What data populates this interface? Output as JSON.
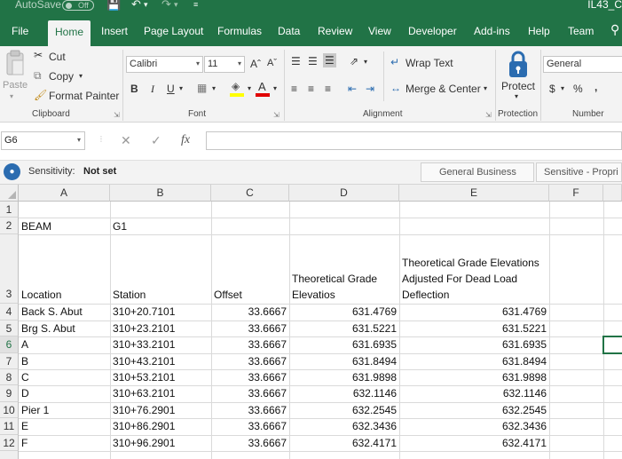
{
  "titlebar": {
    "autosave": "AutoSave",
    "autosave_state": "Off",
    "doc_name": "IL43_C"
  },
  "tabs": [
    {
      "label": "File"
    },
    {
      "label": "Home"
    },
    {
      "label": "Insert"
    },
    {
      "label": "Page Layout"
    },
    {
      "label": "Formulas"
    },
    {
      "label": "Data"
    },
    {
      "label": "Review"
    },
    {
      "label": "View"
    },
    {
      "label": "Developer"
    },
    {
      "label": "Add-ins"
    },
    {
      "label": "Help"
    },
    {
      "label": "Team"
    }
  ],
  "ribbon": {
    "clipboard": {
      "label": "Clipboard",
      "paste": "Paste",
      "cut": "Cut",
      "copy": "Copy",
      "format_painter": "Format Painter"
    },
    "font": {
      "label": "Font",
      "name": "Calibri",
      "size": "11",
      "bold": "B",
      "italic": "I",
      "underline": "U"
    },
    "alignment": {
      "label": "Alignment",
      "wrap_text": "Wrap Text",
      "merge_center": "Merge & Center"
    },
    "protection": {
      "label": "Protection",
      "protect": "Protect"
    },
    "number": {
      "label": "Number",
      "format": "General",
      "currency": "$",
      "percent": "%",
      "comma": ","
    }
  },
  "formula_bar": {
    "name_box": "G6",
    "fx": "fx",
    "formula": ""
  },
  "sensitivity": {
    "label": "Sensitivity:",
    "value": "Not set",
    "chips": [
      "General Business",
      "Sensitive - Propri"
    ]
  },
  "sheet": {
    "columns": [
      "A",
      "B",
      "C",
      "D",
      "E",
      "F"
    ],
    "rows": [
      "1",
      "2",
      "3",
      "4",
      "5",
      "6",
      "7",
      "8",
      "9",
      "10",
      "11",
      "12"
    ],
    "active_row": "6",
    "beam_label": "BEAM",
    "beam_value": "G1",
    "headers": {
      "location": "Location",
      "station": "Station",
      "offset": "Offset",
      "theoretical": "Theoretical Grade Elevatios",
      "adjusted": "Theoretical Grade Elevations Adjusted For Dead Load Deflection"
    },
    "data": [
      {
        "location": "Back  S. Abut",
        "station": "310+20.7101",
        "offset": "33.6667",
        "theo": "631.4769",
        "adj": "631.4769"
      },
      {
        "location": "Brg S. Abut",
        "station": "310+23.2101",
        "offset": "33.6667",
        "theo": "631.5221",
        "adj": "631.5221"
      },
      {
        "location": "A",
        "station": "310+33.2101",
        "offset": "33.6667",
        "theo": "631.6935",
        "adj": "631.6935"
      },
      {
        "location": "B",
        "station": "310+43.2101",
        "offset": "33.6667",
        "theo": "631.8494",
        "adj": "631.8494"
      },
      {
        "location": "C",
        "station": "310+53.2101",
        "offset": "33.6667",
        "theo": "631.9898",
        "adj": "631.9898"
      },
      {
        "location": "D",
        "station": "310+63.2101",
        "offset": "33.6667",
        "theo": "632.1146",
        "adj": "632.1146"
      },
      {
        "location": "Pier 1",
        "station": "310+76.2901",
        "offset": "33.6667",
        "theo": "632.2545",
        "adj": "632.2545"
      },
      {
        "location": "E",
        "station": "310+86.2901",
        "offset": "33.6667",
        "theo": "632.3436",
        "adj": "632.3436"
      },
      {
        "location": "F",
        "station": "310+96.2901",
        "offset": "33.6667",
        "theo": "632.4171",
        "adj": "632.4171"
      }
    ]
  }
}
